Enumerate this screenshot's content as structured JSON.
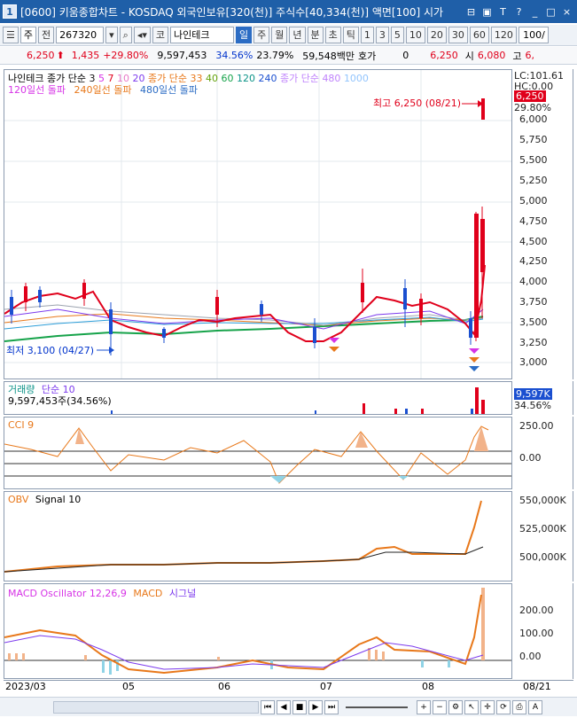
{
  "window": {
    "title": "[0600] 키움종합차트 - KOSDAQ 외국인보유[320(천)] 주식수[40,334(천)] 액면[100] 시가",
    "app_number": "1",
    "title_buttons": [
      "⊟",
      "▣",
      "T",
      "?",
      "_",
      "□",
      "×"
    ]
  },
  "toolbar": {
    "period_select": "주",
    "prev_label": "전",
    "code_value": "267320",
    "stock_prefix": "코",
    "stock_name": "나인테크",
    "timeframes": [
      "일",
      "주",
      "월",
      "년",
      "분",
      "초",
      "틱"
    ],
    "active_timeframe": "일",
    "intervals": [
      "1",
      "3",
      "5",
      "10",
      "20",
      "30",
      "60",
      "120"
    ],
    "count_value": "100/"
  },
  "info": {
    "price": "6,250",
    "change": "1,435",
    "change_pct": "+29.80%",
    "volume": "9,597,453",
    "turnover_pct": "34.56%",
    "ratio": "23.79%",
    "amount": "59,548백만",
    "quote_label": "호가",
    "quote_value": "0",
    "last_price": "6,250",
    "open_label": "시",
    "open_value": "6,080",
    "high_label": "고",
    "high_value": "6,"
  },
  "price_pane": {
    "legend_stock": "나인테크",
    "legend_ma_label": "종가 단순",
    "legend_ma": [
      "3",
      "5",
      "7",
      "10",
      "20"
    ],
    "legend_ma2_label": "종가 단순",
    "legend_ma2": [
      "33",
      "40",
      "60",
      "120",
      "240"
    ],
    "legend_ma3_label": "종가 단순",
    "legend_ma3": [
      "480",
      "1000"
    ],
    "line2_a": "120일선 돌파",
    "line2_b": "240일선 돌파",
    "line2_c": "480일선 돌파",
    "high_note": "최고 6,250 (08/21)",
    "low_note": "최저 3,100 (04/27)",
    "lc_label": "LC:101.61",
    "hc_label": "HC:0.00",
    "price_tag": "6,250",
    "pct_tag": "29.80%",
    "ticks": [
      "6,000",
      "5,750",
      "5,500",
      "5,250",
      "5,000",
      "4,750",
      "4,500",
      "4,250",
      "4,000",
      "3,750",
      "3,500",
      "3,250",
      "3,000"
    ]
  },
  "volume_pane": {
    "title": "거래량",
    "ma_label": "단순 10",
    "value_label": "9,597,453주(34.56%)",
    "tag": "9,597K",
    "tag_pct": "34.56%"
  },
  "cci_pane": {
    "title": "CCI 9",
    "ticks": [
      "250.00",
      "0.00"
    ]
  },
  "obv_pane": {
    "title": "OBV",
    "signal": "Signal 10",
    "ticks": [
      "550,000K",
      "525,000K",
      "500,000K"
    ]
  },
  "macd_pane": {
    "title": "MACD Oscillator 12,26,9",
    "macd": "MACD",
    "signal": "시그널",
    "ticks": [
      "200.00",
      "100.00",
      "0.00"
    ]
  },
  "xaxis": {
    "labels": [
      "2023/03",
      "05",
      "06",
      "07",
      "08"
    ],
    "end_label": "08/21"
  },
  "colors": {
    "up": "#e0001b",
    "down": "#1a4fd0",
    "accent": "#2b6cc4",
    "orange": "#e8781a"
  }
}
